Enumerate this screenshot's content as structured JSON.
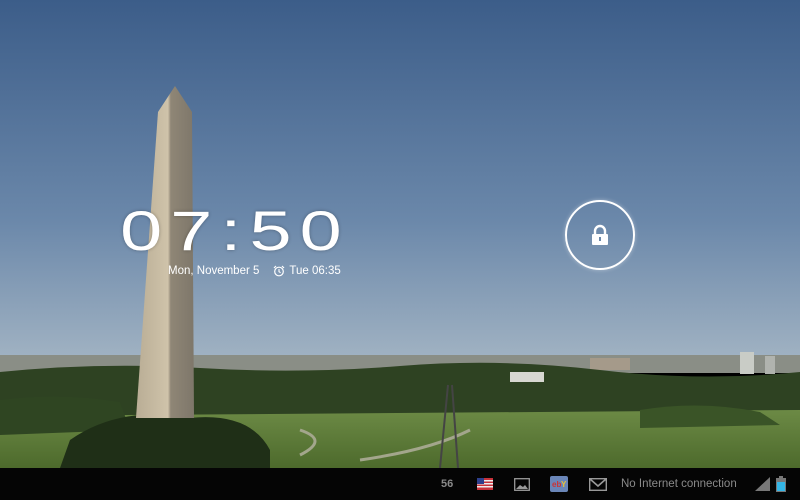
{
  "lockscreen": {
    "time": "07:50",
    "date": "Mon, November 5",
    "alarm": "Tue 06:35"
  },
  "status_bar": {
    "notification_count": "56",
    "connection_status": "No Internet connection",
    "icons": [
      "flag-icon",
      "image-icon",
      "ebay-icon",
      "gmail-icon",
      "signal-icon",
      "battery-icon"
    ]
  },
  "colors": {
    "accent": "#33b5e5",
    "sky_top": "#3d5e8a",
    "sky_horizon": "#9bb0c4"
  }
}
